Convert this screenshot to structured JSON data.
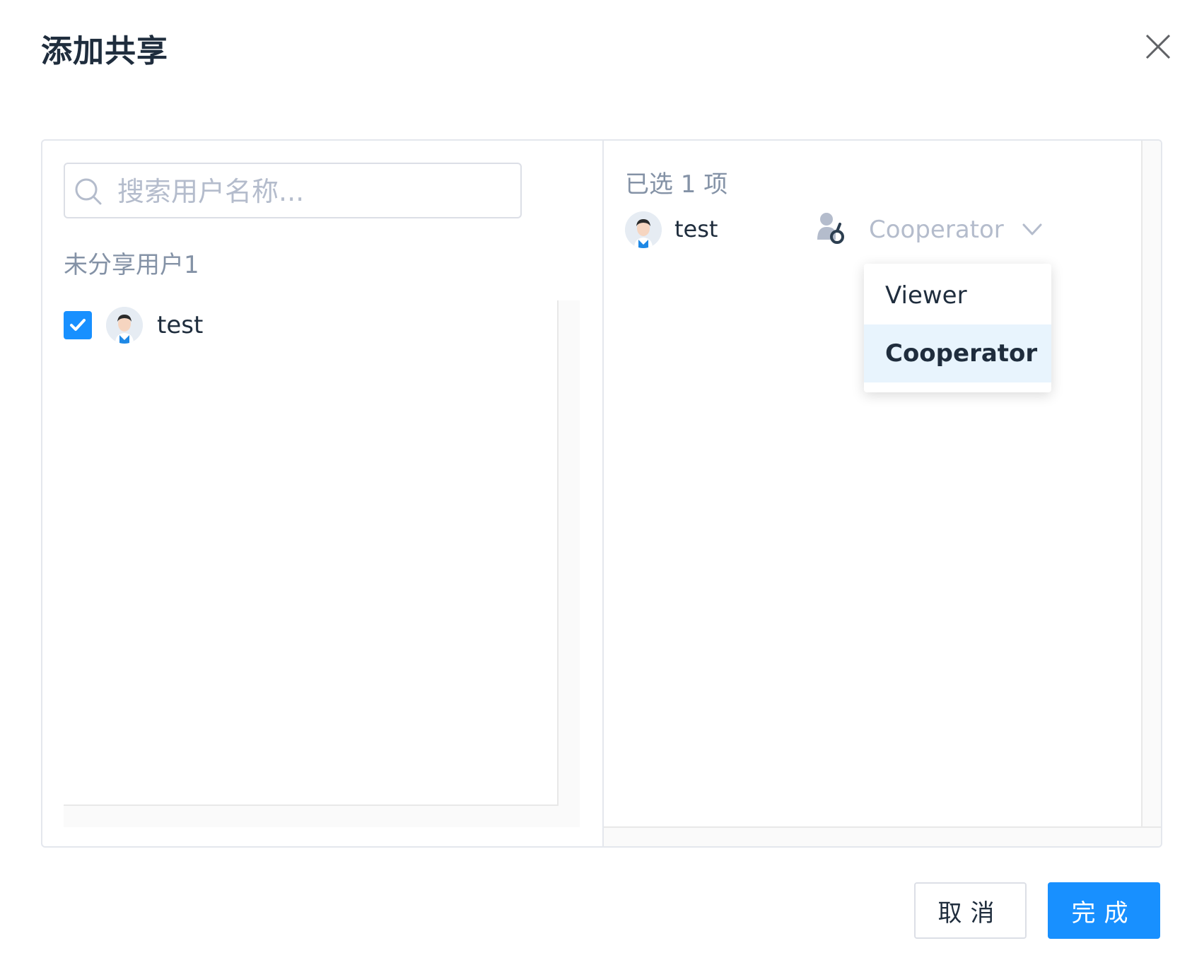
{
  "dialog": {
    "title": "添加共享"
  },
  "search": {
    "placeholder": "搜索用户名称..."
  },
  "left": {
    "unshared_label": "未分享用户1",
    "users": [
      {
        "name": "test",
        "checked": true
      }
    ]
  },
  "right": {
    "selected_count": "已选 1 项",
    "selected_users": [
      {
        "name": "test",
        "role": "Cooperator"
      }
    ]
  },
  "role_dropdown": {
    "options": [
      "Viewer",
      "Cooperator"
    ],
    "active": "Cooperator"
  },
  "footer": {
    "cancel_label": "取消",
    "ok_label": "完成"
  },
  "colors": {
    "primary": "#1890ff",
    "dropdown_active_bg": "#e8f4fd",
    "muted_text": "#8492a6",
    "placeholder_text": "#b4bccc"
  },
  "icons": [
    "close-icon",
    "search-icon",
    "check-icon",
    "avatar",
    "role-icon",
    "chevron-down-icon"
  ]
}
